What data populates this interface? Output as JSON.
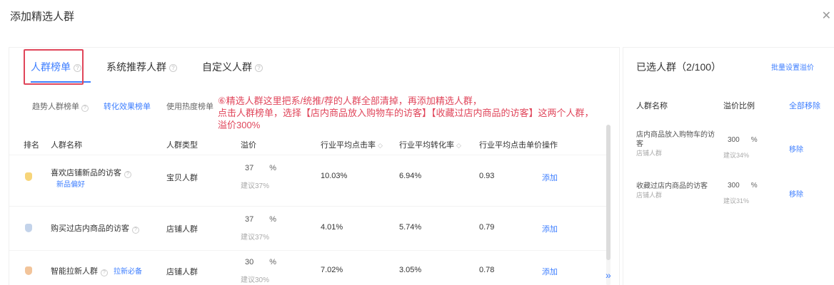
{
  "dialog": {
    "title": "添加精选人群"
  },
  "tabs": [
    {
      "label": "人群榜单"
    },
    {
      "label": "系统推荐人群"
    },
    {
      "label": "自定义人群"
    }
  ],
  "subtabs": [
    {
      "label": "趋势人群榜单"
    },
    {
      "label": "转化效果榜单"
    },
    {
      "label": "使用热度榜单"
    }
  ],
  "annotation": {
    "line1": "⑥精选人群这里把系/统推/荐的人群全部清掉，再添加精选人群，",
    "line2": "点击人群榜单，选择【店内商品放入购物车的访客】【收藏过店内商品的访客】这两个人群，",
    "line3": "溢价300%"
  },
  "table": {
    "headers": {
      "rank": "排名",
      "name": "人群名称",
      "type": "人群类型",
      "premium": "溢价",
      "ctr": "行业平均点击率",
      "cvr": "行业平均转化率",
      "cpc": "行业平均点击单价",
      "action": "操作"
    },
    "rows": [
      {
        "name": "喜欢店铺新品的访客",
        "tag": "新品偏好",
        "type": "宝贝人群",
        "premium": "37",
        "suggest": "建议37%",
        "ctr": "10.03%",
        "cvr": "6.94%",
        "cpc": "0.93",
        "action": "添加",
        "medal": "gold"
      },
      {
        "name": "购买过店内商品的访客",
        "tag": "",
        "type": "店铺人群",
        "premium": "37",
        "suggest": "建议37%",
        "ctr": "4.01%",
        "cvr": "5.74%",
        "cpc": "0.79",
        "action": "添加",
        "medal": "silver"
      },
      {
        "name": "智能拉新人群",
        "tag": "拉新必备",
        "type": "店铺人群",
        "premium": "30",
        "suggest": "建议30%",
        "ctr": "7.02%",
        "cvr": "3.05%",
        "cpc": "0.78",
        "action": "添加",
        "medal": "bronze"
      }
    ],
    "percent_sign": "%"
  },
  "selected": {
    "title": "已选人群（2/100）",
    "batch_label": "批量设置溢价",
    "headers": {
      "name": "人群名称",
      "ratio": "溢价比例",
      "remove_all": "全部移除"
    },
    "items": [
      {
        "name": "店内商品放入购物车的访客",
        "sub": "店铺人群",
        "value": "300",
        "suggest": "建议34%",
        "action": "移除"
      },
      {
        "name": "收藏过店内商品的访客",
        "sub": "店铺人群",
        "value": "300",
        "suggest": "建议31%",
        "action": "移除"
      }
    ],
    "percent_sign": "%"
  },
  "icons": {
    "close": "close-icon",
    "help": "question-circle-icon",
    "sort": "sort-icon",
    "expand": "double-chevron-right-icon"
  },
  "colors": {
    "accent": "#3d7eff",
    "annotation": "#e0455a"
  }
}
